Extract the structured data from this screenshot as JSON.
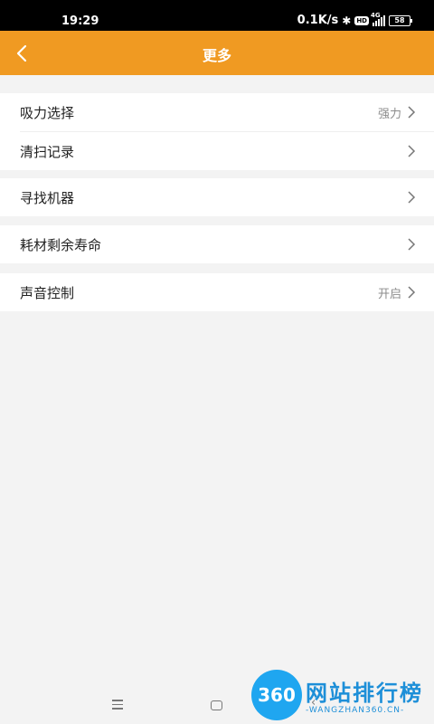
{
  "status_bar": {
    "time": "19:29",
    "net_speed": "0.1K/s",
    "hd_badge": "HD",
    "signal_type": "4G",
    "battery": "58"
  },
  "header": {
    "title": "更多",
    "background_color": "#f09a22"
  },
  "settings": {
    "suction": {
      "label": "吸力选择",
      "value": "强力"
    },
    "clean_record": {
      "label": "清扫记录"
    },
    "find_robot": {
      "label": "寻找机器"
    },
    "consumables": {
      "label": "耗材剩余寿命"
    },
    "sound": {
      "label": "声音控制",
      "value": "开启"
    }
  },
  "watermark": {
    "logo_text": "360",
    "title": "网站排行榜",
    "subtitle": "-WANGZHAN360.CN-"
  }
}
